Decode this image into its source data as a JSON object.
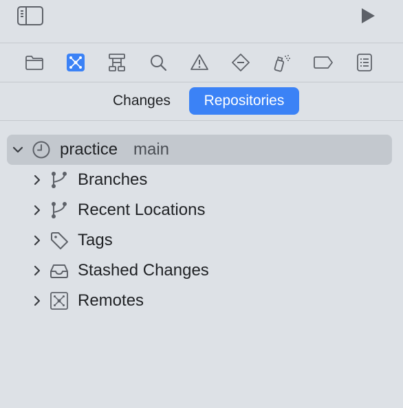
{
  "toolbar": {
    "sidebar_toggle_icon": "sidebar-icon",
    "run_icon": "play-icon"
  },
  "navigator_icons": [
    {
      "name": "folder-icon",
      "active": false
    },
    {
      "name": "source-control-icon",
      "active": true
    },
    {
      "name": "hierarchy-icon",
      "active": false
    },
    {
      "name": "search-icon",
      "active": false
    },
    {
      "name": "warning-icon",
      "active": false
    },
    {
      "name": "test-diamond-icon",
      "active": false
    },
    {
      "name": "debug-spray-icon",
      "active": false
    },
    {
      "name": "breakpoint-tag-icon",
      "active": false
    },
    {
      "name": "report-list-icon",
      "active": false
    }
  ],
  "segments": {
    "changes_label": "Changes",
    "repositories_label": "Repositories",
    "active": "Repositories"
  },
  "tree": {
    "repo": {
      "name": "practice",
      "branch": "main",
      "expanded": true
    },
    "items": [
      {
        "label": "Branches",
        "icon": "branch-icon"
      },
      {
        "label": "Recent Locations",
        "icon": "branch-icon"
      },
      {
        "label": "Tags",
        "icon": "tag-icon"
      },
      {
        "label": "Stashed Changes",
        "icon": "tray-icon"
      },
      {
        "label": "Remotes",
        "icon": "remote-icon"
      }
    ]
  },
  "colors": {
    "background": "#dde1e6",
    "accent": "#3b82f6",
    "selection": "#c3c8ce",
    "icon_gray": "#5d6168"
  }
}
